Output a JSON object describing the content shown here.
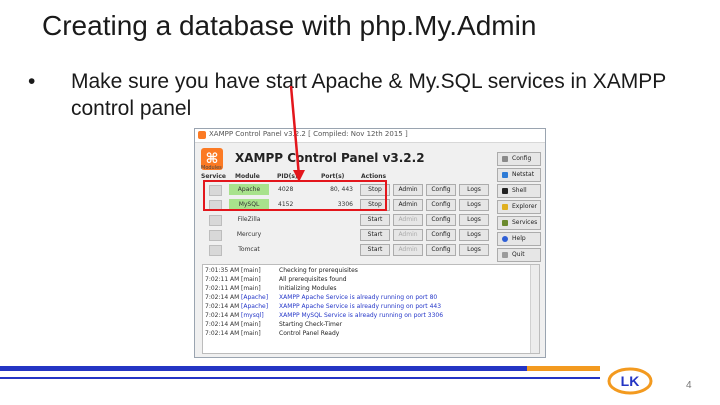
{
  "slide": {
    "title": "Creating a database with php.My.Admin",
    "bullet_symbol": "•",
    "bullet_text": "Make sure you have start Apache & My.SQL services in XAMPP control panel",
    "page_number": "4",
    "logo_text": "LK"
  },
  "xampp": {
    "window_title": "XAMPP Control Panel v3.2.2    [ Compiled: Nov 12th 2015 ]",
    "logo_glyph": "⌘",
    "heading": "XAMPP Control Panel v3.2.2",
    "modules_label": "Modules",
    "columns": {
      "service": "Service",
      "module": "Module",
      "pid": "PID(s)",
      "port": "Port(s)",
      "actions": "Actions"
    },
    "modules": [
      {
        "name": "Apache",
        "pid": "4028",
        "port": "80, 443",
        "action": "Stop",
        "admin": "Admin",
        "config": "Config",
        "logs": "Logs"
      },
      {
        "name": "MySQL",
        "pid": "4152",
        "port": "3306",
        "action": "Stop",
        "admin": "Admin",
        "config": "Config",
        "logs": "Logs"
      },
      {
        "name": "FileZilla",
        "pid": "",
        "port": "",
        "action": "Start",
        "admin": "Admin",
        "config": "Config",
        "logs": "Logs"
      },
      {
        "name": "Mercury",
        "pid": "",
        "port": "",
        "action": "Start",
        "admin": "Admin",
        "config": "Config",
        "logs": "Logs"
      },
      {
        "name": "Tomcat",
        "pid": "",
        "port": "",
        "action": "Start",
        "admin": "Admin",
        "config": "Config",
        "logs": "Logs"
      }
    ],
    "side_buttons": [
      {
        "label": "Config",
        "icon": "wrench-icon",
        "color": "#8a8a8a"
      },
      {
        "label": "Netstat",
        "icon": "network-icon",
        "color": "#2e7bd6"
      },
      {
        "label": "Shell",
        "icon": "terminal-icon",
        "color": "#222222"
      },
      {
        "label": "Explorer",
        "icon": "folder-icon",
        "color": "#e0b020"
      },
      {
        "label": "Services",
        "icon": "services-icon",
        "color": "#6b8a2e"
      },
      {
        "label": "Help",
        "icon": "help-icon",
        "color": "#2e5fd6"
      },
      {
        "label": "Quit",
        "icon": "quit-icon",
        "color": "#9a9a9a"
      }
    ],
    "log": [
      {
        "time": "7:01:35 AM",
        "module": "[main]",
        "text": "Checking for prerequisites",
        "style": "black"
      },
      {
        "time": "7:02:11 AM",
        "module": "[main]",
        "text": "All prerequisites found",
        "style": "black"
      },
      {
        "time": "7:02:11 AM",
        "module": "[main]",
        "text": "Initializing Modules",
        "style": "black"
      },
      {
        "time": "7:02:14 AM",
        "module": "[Apache]",
        "text": "XAMPP Apache Service is already running on port 80",
        "style": "blue"
      },
      {
        "time": "7:02:14 AM",
        "module": "[Apache]",
        "text": "XAMPP Apache Service is already running on port 443",
        "style": "blue"
      },
      {
        "time": "7:02:14 AM",
        "module": "[mysql]",
        "text": "XAMPP MySQL Service is already running on port 3306",
        "style": "blue"
      },
      {
        "time": "7:02:14 AM",
        "module": "[main]",
        "text": "Starting Check-Timer",
        "style": "black"
      },
      {
        "time": "7:02:14 AM",
        "module": "[main]",
        "text": "Control Panel Ready",
        "style": "black"
      }
    ]
  },
  "colors": {
    "accent_blue": "#2435c4",
    "accent_orange": "#f39a1f",
    "highlight_red": "#e3161c",
    "running_green": "#a8e28c"
  }
}
